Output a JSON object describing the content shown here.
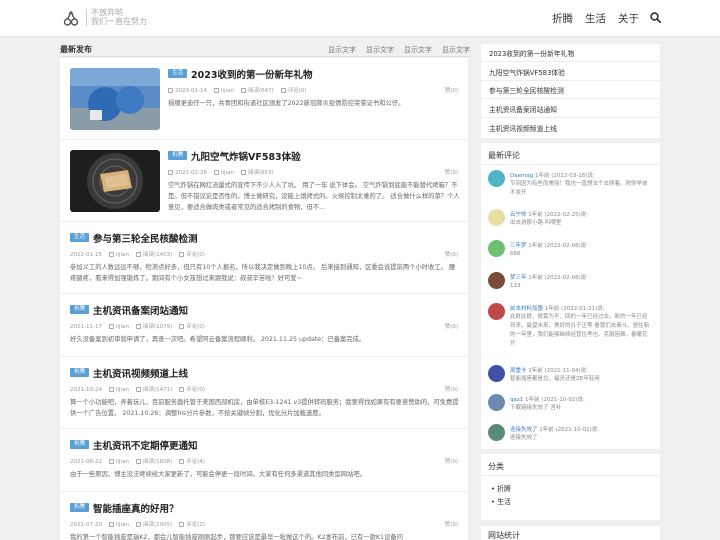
{
  "header": {
    "tagline_line1": "不放弃哟",
    "tagline_line2": "我们一直在努力",
    "nav": [
      "折腾",
      "生活",
      "关于"
    ]
  },
  "main": {
    "section_title": "最新发布",
    "filters": [
      "显示文字",
      "显示文字",
      "显示文字",
      "显示文字"
    ]
  },
  "posts": [
    {
      "badge": "生活",
      "title": "2023收到的第一份新年礼物",
      "date": "2023-01-14",
      "author": "lijian",
      "views": "阅读(647)",
      "comments": "评论(0)",
      "likes": "赞(0)",
      "excerpt": "捐赠更迪仔一只，共青团和街道社区颁发了2022新冠肺炎疫情防控荣誉证书和公仔。"
    },
    {
      "badge": "折腾",
      "title": "九阳空气炸锅VF583体验",
      "date": "2022-02-26",
      "author": "lijian",
      "views": "阅读(653)",
      "comments": "评论(0)",
      "likes": "赞(0)",
      "excerpt": "空气炸锅在网红流量式的宣传下不少人入了坑。 用了一年 说下体会。 空气炸锅到底能不能替代烤箱？不是。但不错议论是否性的，博士做研究，没能上熄烤式的。火候控制太难的了。 适合做什么样的菜？个人意见，要适合做肉类或者常见的适合烤制的食物，但不..."
    },
    {
      "badge": "生活",
      "title": "参与第三轮全民核酸检测",
      "date": "2022-01-15",
      "author": "lijian",
      "views": "阅读(1403)",
      "comments": "评论(0)",
      "likes": "赞(0)",
      "excerpt": "参加义工的人数远远不够，检测点好多，但只有10个人报名，所以我决定做到晚上10点。 后来接到通知，区委会说提前两个小时收工。 腰疼腿疼，看来得加强锻炼了。期间有个小女孩想过来跟我说：叔叔辛苦啦！好可爱~"
    },
    {
      "badge": "折腾",
      "title": "主机资讯备案闭站通知",
      "date": "2021-11-17",
      "author": "lijian",
      "views": "阅读(1079)",
      "comments": "评论(0)",
      "likes": "赞(0)",
      "excerpt": "好久没备案到初审就申请了，再查一次吧。希望阿云备案流程顺利。 2021.11.25 update：已备案完成。"
    },
    {
      "badge": "折腾",
      "title": "主机资讯视频频道上线",
      "date": "2021-10-24",
      "author": "lijian",
      "views": "阅读(1471)",
      "comments": "评论(0)",
      "likes": "赞(0)",
      "excerpt": "算一个小功能吧，弄着玩儿，目前服务器托管于美国西部机房，由单核E3-1241 v3提供转码服务；我要得找如果有有要意赞助的，可免费提供一个广告位置。 2021.10.26：调整hls分片参数，不按关键帧分割，优化分片加载速度。"
    },
    {
      "badge": "折腾",
      "title": "主机资讯不定期停更通知",
      "date": "2021-08-22",
      "author": "lijian",
      "views": "阅读(1808)",
      "comments": "评论(4)",
      "likes": "赞(0)",
      "excerpt": "由于一些原因，博主没法继续给大家更新了，可能会停更一段时间。大家有任何多渠道其他同类型网站吧。"
    },
    {
      "badge": "折腾",
      "title": "智能插座真的好用？",
      "date": "2021-07-20",
      "author": "lijian",
      "views": "阅读(1905)",
      "comments": "评论(2)",
      "likes": "赞(0)",
      "excerpt": "我的第一个智能插座是瑞K2，都会儿智能插座刚刚起步，那要应该是最早一批做这个的。K2发布前，已有一款K1设备问"
    }
  ],
  "sidebar": {
    "recent": [
      "2023收到的第一份新年礼物",
      "九阳空气炸锅VF583体验",
      "参与第三轮全民核酸检测",
      "主机资讯备案闭站通知",
      "主机资讯视频频道上线"
    ],
    "comments_title": "最新评论",
    "comments": [
      {
        "name": "Daemag",
        "meta": " 1年前 (2022-03-16)说:",
        "text": "节间因为有些而美丽！我也一直想法个去爬着。祝你早体不发开",
        "color": "#4fb3c6"
      },
      {
        "name": "云宁帅",
        "meta": " 1年前 (2022-02-25)说:",
        "text": "出去游那小路 叫哪里",
        "color": "#e8e0a0"
      },
      {
        "name": "三年梦",
        "meta": " 1年前 (2022-02-08)说:",
        "text": "666",
        "color": "#6cc070"
      },
      {
        "name": "梦三年",
        "meta": " 1年前 (2022-02-08)说:",
        "text": "123",
        "color": "#7a4a3a"
      },
      {
        "name": "前本材料加盟",
        "meta": " 1年前 (2022-01-21)说:",
        "text": "此财此财、很黄为不、回的一年已经过去。新的一年已经到来。最望未来，美好的日子正等 看我们去奋斗。居住新的一年里，我们能够继续经营住考也。克服困难，春暖花开",
        "color": "#c04848"
      },
      {
        "name": "周重卡",
        "meta": " 1年前 (2021-11-04)说:",
        "text": "智能插座都是垃，福灵还是ZE年轻用",
        "color": "#4050a8"
      },
      {
        "name": "qaz1",
        "meta": " 1年前 (2021-10-02)说:",
        "text": "下载链接失效了 咨补",
        "color": "#6a8ab0"
      },
      {
        "name": "连接失效了",
        "meta": " 1年前 (2021-10-01)说:",
        "text": "连接失效了",
        "color": "#5a8a78"
      }
    ],
    "category_title": "分类",
    "categories": [
      "折腾",
      "生活"
    ],
    "stats_title": "网站统计"
  },
  "colors": {
    "badge": "#58a0d6",
    "link": "#3a7fc1"
  }
}
